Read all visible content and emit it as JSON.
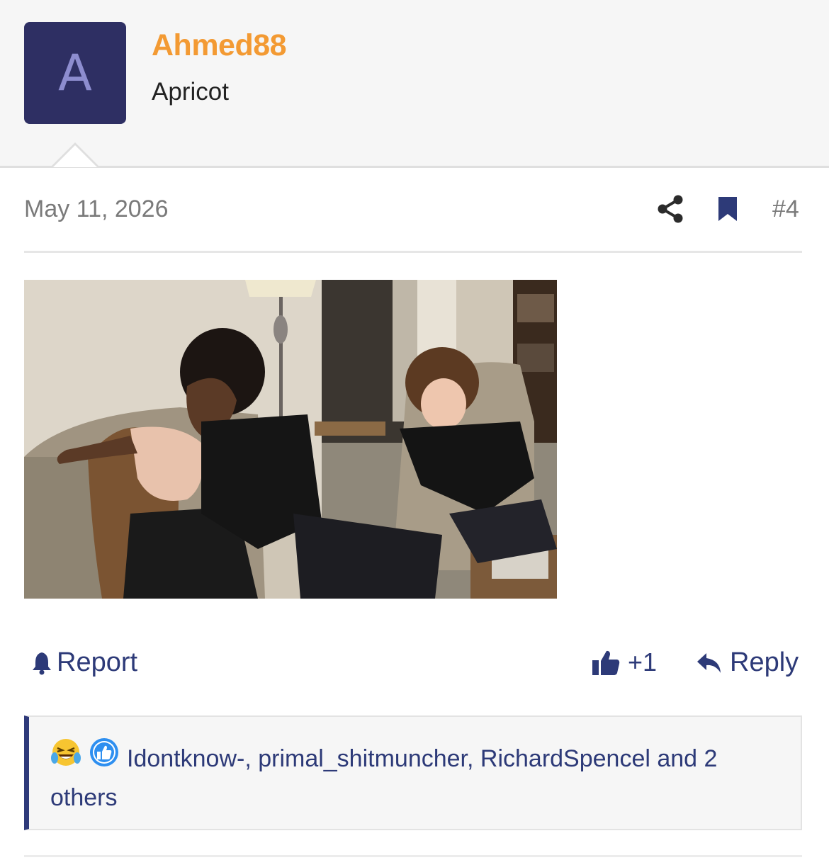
{
  "post": {
    "author": {
      "initial": "A",
      "username": "Ahmed88",
      "title": "Apricot",
      "avatar_color": "#2e2f63",
      "username_color": "#f39a33"
    },
    "date": "May 11, 2026",
    "post_number": "#4",
    "icons": {
      "share": "share-icon",
      "bookmark": "bookmark-icon"
    }
  },
  "actions": {
    "report_label": "Report",
    "like_count": "+1",
    "reply_label": "Reply"
  },
  "reactions": {
    "users_text": "Idontknow-, primal_shitmuncher, RichardSpencel and 2 others",
    "emoji": [
      "laughing-crying-emoji",
      "thumbs-up-emoji"
    ]
  },
  "colors": {
    "link": "#2d3a78",
    "muted": "#7a7a7a"
  }
}
